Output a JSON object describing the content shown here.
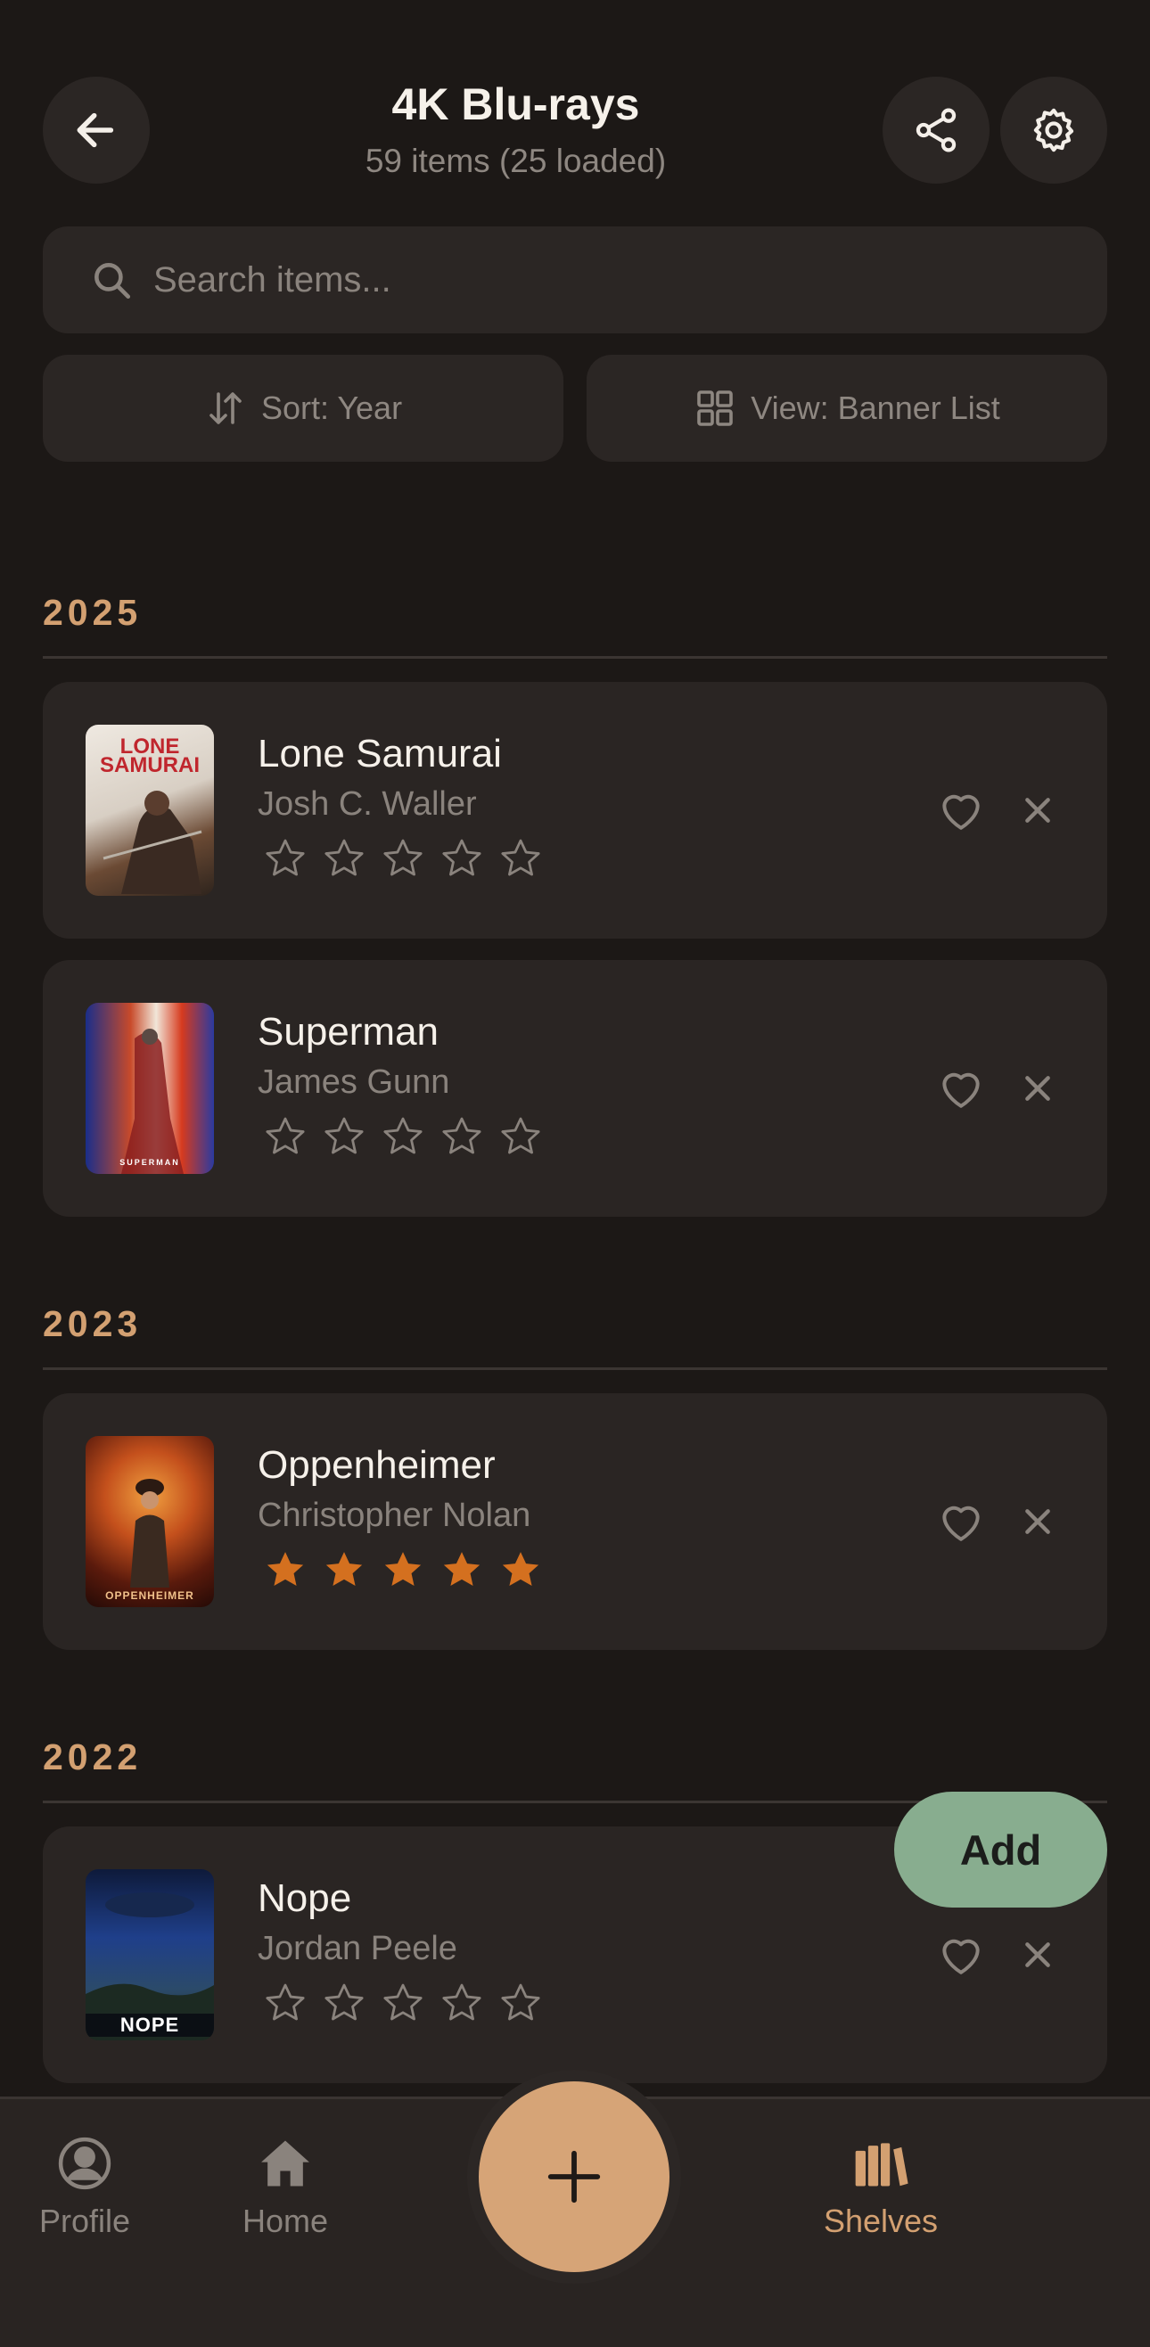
{
  "header": {
    "title": "4K Blu-rays",
    "subtitle": "59 items (25 loaded)"
  },
  "search": {
    "placeholder": "Search items..."
  },
  "controls": {
    "sort_label": "Sort: Year",
    "view_label": "View: Banner List"
  },
  "sections": [
    {
      "year": "2025",
      "items": [
        {
          "title": "Lone Samurai",
          "director": "Josh C. Waller",
          "rating": 0,
          "poster_text": "LONE SAMURAI"
        },
        {
          "title": "Superman",
          "director": "James Gunn",
          "rating": 0,
          "poster_text": "SUPERMAN"
        }
      ]
    },
    {
      "year": "2023",
      "items": [
        {
          "title": "Oppenheimer",
          "director": "Christopher Nolan",
          "rating": 5,
          "poster_text": "OPPENHEIMER"
        }
      ]
    },
    {
      "year": "2022",
      "items": [
        {
          "title": "Nope",
          "director": "Jordan Peele",
          "rating": 0,
          "poster_text": "NOPE"
        }
      ]
    }
  ],
  "add_button_label": "Add",
  "bottom_nav": {
    "profile": "Profile",
    "home": "Home",
    "shelves": "Shelves",
    "active": "shelves"
  },
  "icons": {
    "back": "arrow-left-icon",
    "share": "share-icon",
    "settings": "gear-icon",
    "search": "search-icon",
    "sort": "sort-arrows-icon",
    "view": "grid-icon",
    "favorite": "heart-icon",
    "remove": "close-icon",
    "rating": "star-icon",
    "profile": "user-circle-icon",
    "home": "home-icon",
    "shelves": "books-icon",
    "create": "plus-icon"
  },
  "colors": {
    "background": "#1c1816",
    "card": "#2a2523",
    "accent": "#d3a071",
    "add_button": "#88ad8f",
    "star_filled": "#d4701f",
    "muted_text": "#8a837d"
  }
}
